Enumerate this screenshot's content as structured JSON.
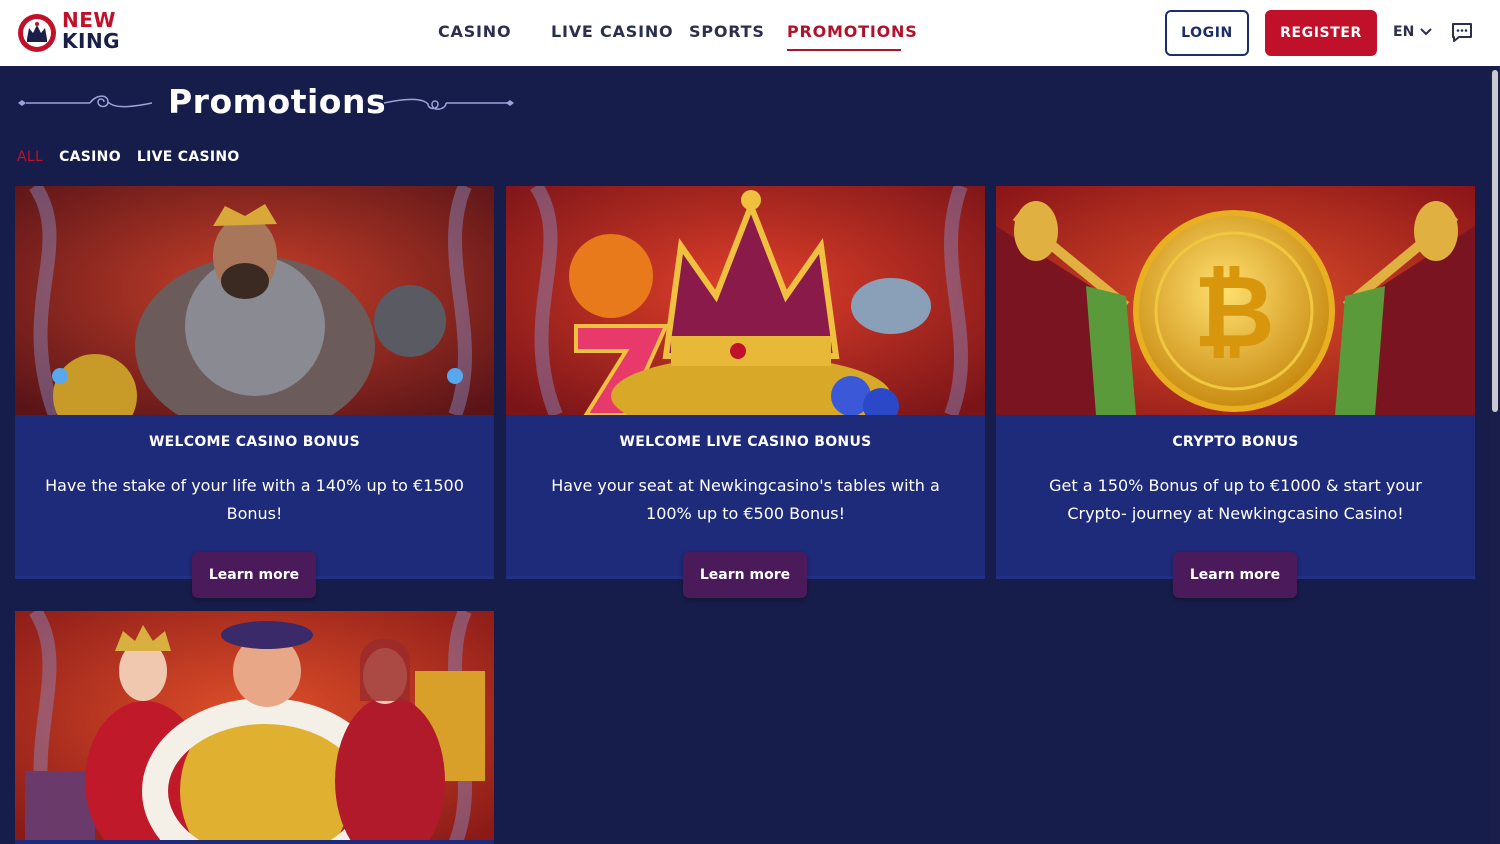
{
  "brand": {
    "line1": "NEW",
    "line2": "KING"
  },
  "nav": {
    "items": [
      {
        "label": "CASINO"
      },
      {
        "label": "LIVE CASINO"
      },
      {
        "label": "SPORTS"
      },
      {
        "label": "PROMOTIONS",
        "active": true
      }
    ]
  },
  "header": {
    "login_label": "LOGIN",
    "register_label": "REGISTER",
    "language": "EN"
  },
  "page": {
    "title": "Promotions"
  },
  "filters": [
    {
      "label": "ALL",
      "active": true
    },
    {
      "label": "CASINO"
    },
    {
      "label": "LIVE CASINO"
    }
  ],
  "promotions": [
    {
      "title": "WELCOME CASINO BONUS",
      "description": "Have the stake of your life with a 140% up to €1500 Bonus!",
      "cta": "Learn more",
      "image": "king-warrior-art"
    },
    {
      "title": "WELCOME LIVE CASINO BONUS",
      "description": "Have your seat at Newkingcasino's tables with a 100% up to €500 Bonus!",
      "cta": "Learn more",
      "image": "crown-seven-art"
    },
    {
      "title": "CRYPTO BONUS",
      "description": "Get a 150% Bonus of up to €1000 & start your Crypto- journey at Newkingcasino Casino!",
      "cta": "Learn more",
      "image": "bitcoin-trumpets-art"
    },
    {
      "image": "royal-court-art"
    }
  ],
  "colors": {
    "background": "#171d4a",
    "card": "#1e2a7a",
    "accent_red": "#c0102a",
    "cta_purple": "#4a1a5a",
    "nav_text": "#2b2f4e"
  }
}
